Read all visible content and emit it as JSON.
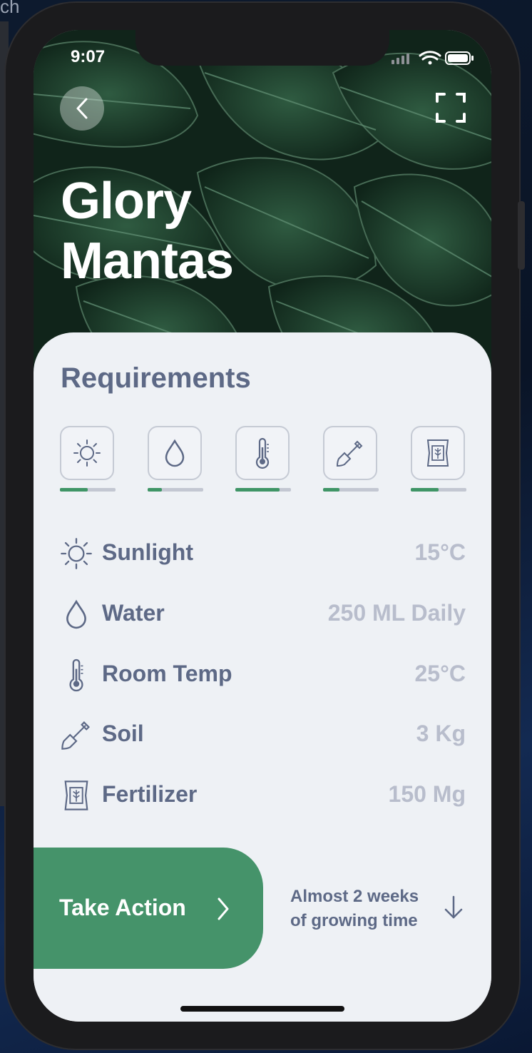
{
  "desktop": {
    "fragment_text": "ch"
  },
  "status_bar": {
    "time": "9:07"
  },
  "header": {
    "title_line1": "Glory",
    "title_line2": "Mantas"
  },
  "requirements": {
    "title": "Requirements",
    "levels": [
      {
        "icon": "sun-icon",
        "fill": 0.5
      },
      {
        "icon": "water-drop-icon",
        "fill": 0.25
      },
      {
        "icon": "thermometer-icon",
        "fill": 0.8
      },
      {
        "icon": "shovel-icon",
        "fill": 0.3
      },
      {
        "icon": "fertilizer-bag-icon",
        "fill": 0.5
      }
    ],
    "items": [
      {
        "label": "Sunlight",
        "value": "15°C",
        "icon": "sun-icon"
      },
      {
        "label": "Water",
        "value": "250 ML Daily",
        "icon": "water-drop-icon"
      },
      {
        "label": "Room Temp",
        "value": "25°C",
        "icon": "thermometer-icon"
      },
      {
        "label": "Soil",
        "value": "3 Kg",
        "icon": "shovel-icon"
      },
      {
        "label": "Fertilizer",
        "value": "150 Mg",
        "icon": "fertilizer-bag-icon"
      }
    ]
  },
  "action": {
    "button_label": "Take Action",
    "growing_line1": "Almost 2 weeks",
    "growing_line2": "of growing time"
  },
  "colors": {
    "accent_green": "#45936a",
    "progress_green": "#3f9566",
    "text_primary": "#5d6986",
    "text_muted": "#b8bdcc",
    "panel_bg": "#eef1f5"
  }
}
